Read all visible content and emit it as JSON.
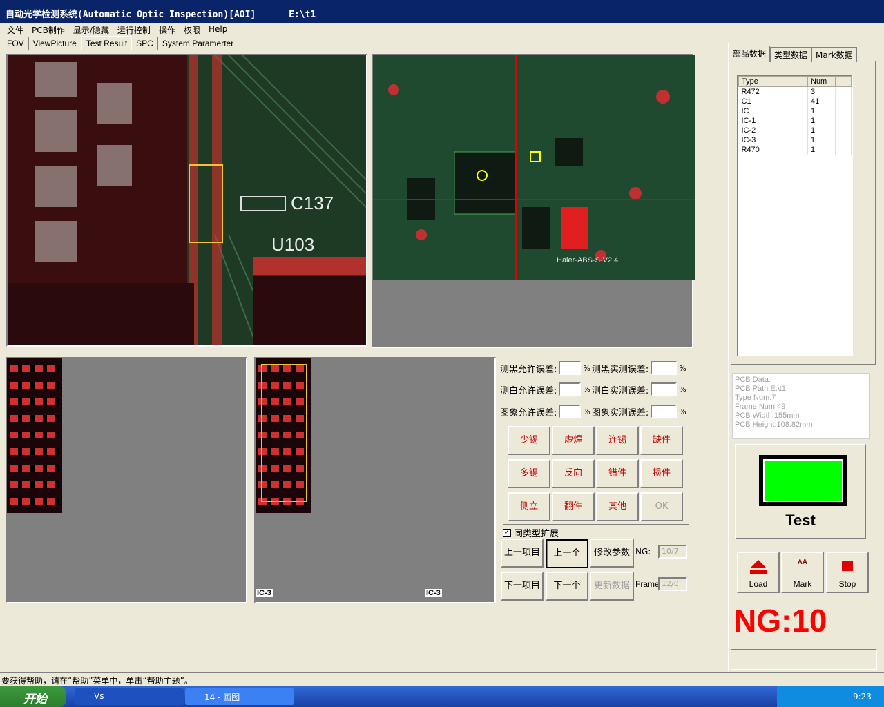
{
  "window": {
    "title": "自动光学检测系统(Automatic Optic Inspection)[AOI]",
    "path": "E:\\t1"
  },
  "menu": [
    "文件",
    "PCB制作",
    "显示/隐藏",
    "运行控制",
    "操作",
    "权限",
    "Help"
  ],
  "tabs": [
    "FOV",
    "ViewPicture",
    "Test Result",
    "SPC",
    "System Paramerter"
  ],
  "active_tab": "Test Result",
  "board": {
    "zoom_labels": [
      "C137",
      "U103"
    ],
    "full_label": "Haier-ABS-S-V2.4"
  },
  "thumbs": {
    "caption_left": "IC-3",
    "caption_right": "IC-3"
  },
  "tolerance": {
    "black_allow": "测黑允许误差:",
    "black_measured": "测黑实测误差:",
    "white_allow": "测白允许误差:",
    "white_measured": "测白实测误差:",
    "image_allow": "图象允许误差:",
    "image_measured": "图象实测误差:",
    "unit": "%"
  },
  "defects": [
    [
      "少锡",
      "虚焊",
      "连锡",
      "缺件"
    ],
    [
      "多锡",
      "反向",
      "错件",
      "损件"
    ],
    [
      "侧立",
      "翻件",
      "其他",
      "OK"
    ]
  ],
  "controls": {
    "expand_label": "同类型扩展",
    "expand_checked": true,
    "prev_item": "上一项目",
    "prev": "上一个",
    "modify": "修改参数",
    "next_item": "下一项目",
    "next": "下一个",
    "update": "更新数据",
    "ng_label": "NG:",
    "ng_value": "10/7",
    "frame_label": "Frame:",
    "frame_value": "12/0"
  },
  "right_tabs": [
    "部品数据",
    "类型数据",
    "Mark数据"
  ],
  "parts": {
    "headers": [
      "Type",
      "Num"
    ],
    "rows": [
      [
        "R472",
        "3"
      ],
      [
        "C1",
        "41"
      ],
      [
        "IC",
        "1"
      ],
      [
        "IC-1",
        "1"
      ],
      [
        "IC-2",
        "1"
      ],
      [
        "IC-3",
        "1"
      ],
      [
        "R470",
        "1"
      ]
    ]
  },
  "pcb_info": [
    "PCB Data:",
    "PCB Path:E:\\t1",
    "Type Num:7",
    "Frame Num:49",
    "PCB Width:155mm",
    "PCB Height:108.82mm"
  ],
  "test": {
    "label": "Test",
    "light_color": "#00ff00"
  },
  "tools": {
    "load": "Load",
    "mark": "Mark",
    "stop": "Stop"
  },
  "ng_display": "NG:10",
  "status": "要获得帮助，请在“帮助”菜单中，单击“帮助主题”。",
  "taskbar": {
    "start": "开始",
    "task1": "Vs",
    "task2": "14 - 画图",
    "time": "9:23"
  }
}
